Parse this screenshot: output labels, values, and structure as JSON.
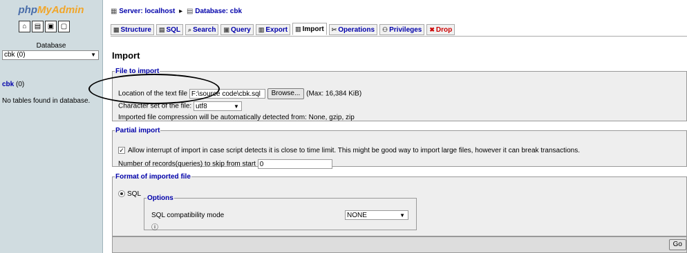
{
  "sidebar": {
    "logo_a": "php",
    "logo_b": "MyAdmin",
    "icons": [
      "home-icon",
      "sql-icon",
      "query-window-icon",
      "docs-icon"
    ],
    "database_label": "Database",
    "database_select": "cbk (0)",
    "db_link": "cbk",
    "db_link_count": "(0)",
    "no_tables": "No tables found in database."
  },
  "breadcrumb": {
    "server": "Server: localhost",
    "database": "Database: cbk"
  },
  "tabs": [
    "Structure",
    "SQL",
    "Search",
    "Query",
    "Export",
    "Import",
    "Operations",
    "Privileges",
    "Drop"
  ],
  "page": {
    "heading": "Import"
  },
  "file_to_import": {
    "legend": "File to import",
    "location_label": "Location of the text file",
    "file_value": "F:\\source code\\cbk.sql",
    "browse_label": "Browse...",
    "max_label": "(Max: 16,384 KiB)",
    "charset_label": "Character set of the file:",
    "charset_value": "utf8",
    "compression_note": "Imported file compression will be automatically detected from: None, gzip, zip"
  },
  "partial_import": {
    "legend": "Partial import",
    "allow_interrupt_label": "Allow interrupt of import in case script detects it is close to time limit. This might be good way to import large files, however it can break transactions.",
    "skip_label": "Number of records(queries) to skip from start",
    "skip_value": "0"
  },
  "format": {
    "legend": "Format of imported file",
    "format_sql": "SQL",
    "options_legend": "Options",
    "compat_label": "SQL compatibility mode",
    "compat_value": "NONE"
  },
  "go_label": "Go"
}
